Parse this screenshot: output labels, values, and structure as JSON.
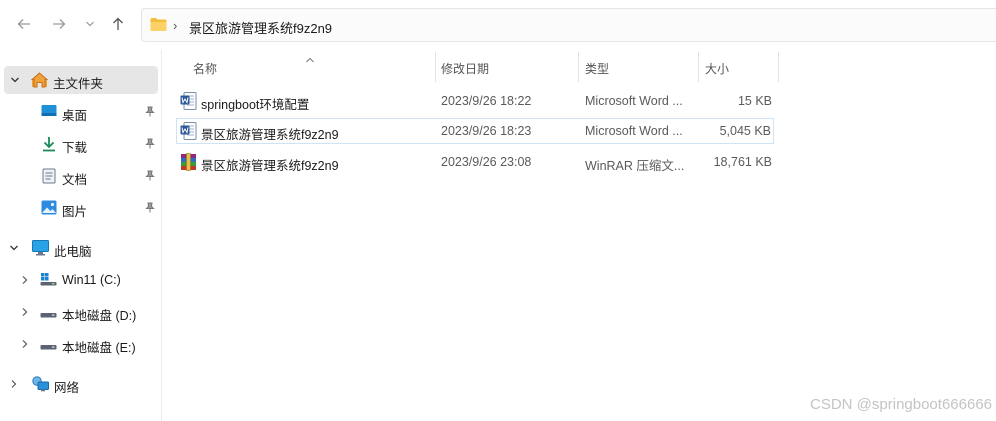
{
  "toolbar": {
    "path_label": "景区旅游管理系统f9z2n9",
    "path_separator": "›"
  },
  "sidebar": {
    "home_label": "主文件夹",
    "quick_access": [
      {
        "label": "桌面",
        "icon": "desktop-icon"
      },
      {
        "label": "下载",
        "icon": "download-icon"
      },
      {
        "label": "文档",
        "icon": "documents-icon"
      },
      {
        "label": "图片",
        "icon": "pictures-icon"
      }
    ],
    "this_pc_label": "此电脑",
    "drives": [
      {
        "label": "Win11 (C:)",
        "icon": "windows-drive-icon"
      },
      {
        "label": "本地磁盘 (D:)",
        "icon": "drive-icon"
      },
      {
        "label": "本地磁盘 (E:)",
        "icon": "drive-icon"
      }
    ],
    "network_label": "网络"
  },
  "columns": {
    "name": "名称",
    "date": "修改日期",
    "type": "类型",
    "size": "大小"
  },
  "files": [
    {
      "name": "springboot环境配置",
      "date": "2023/9/26 18:22",
      "type": "Microsoft Word ...",
      "size": "15 KB",
      "icon": "word-doc-icon"
    },
    {
      "name": "景区旅游管理系统f9z2n9",
      "date": "2023/9/26 18:23",
      "type": "Microsoft Word ...",
      "size": "5,045 KB",
      "icon": "word-doc-icon"
    },
    {
      "name": "景区旅游管理系统f9z2n9",
      "date": "2023/9/26 23:08",
      "type": "WinRAR 压缩文...",
      "size": "18,761 KB",
      "icon": "winrar-archive-icon"
    }
  ],
  "watermark": "CSDN @springboot666666",
  "colors": {
    "accent": "#0067c0",
    "folder": "#f5c242",
    "selection_border": "#cfe3f6"
  }
}
